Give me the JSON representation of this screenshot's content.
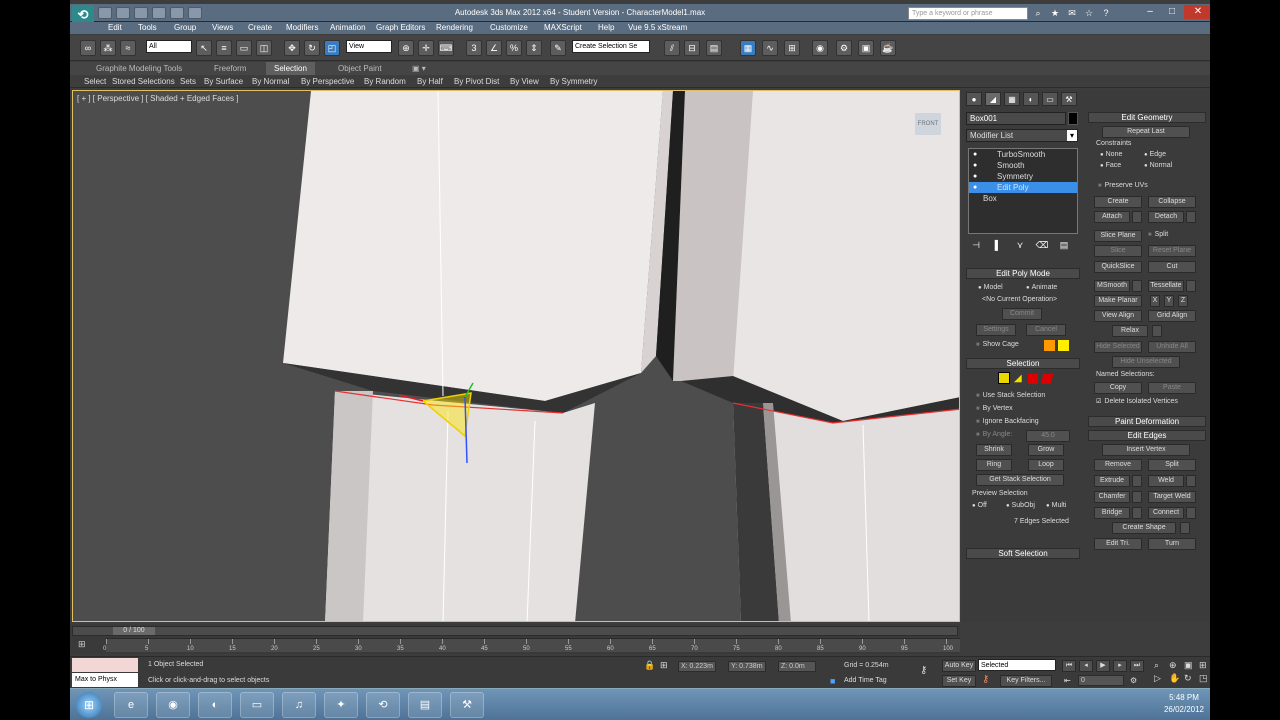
{
  "window": {
    "title": "Autodesk 3ds Max 2012 x64 - Student Version - CharacterModel1.max",
    "search_placeholder": "Type a keyword or phrase"
  },
  "menu": [
    "Edit",
    "Tools",
    "Group",
    "Views",
    "Create",
    "Modifiers",
    "Animation",
    "Graph Editors",
    "Rendering",
    "Customize",
    "MAXScript",
    "Help",
    "Vue 9.5 xStream"
  ],
  "toolbar": {
    "selection_filter": "All",
    "ref_coord": "View",
    "named_selection": "Create Selection Se"
  },
  "ribbon": {
    "tabs": [
      "Graphite Modeling Tools",
      "Freeform",
      "Selection",
      "Object Paint"
    ],
    "active_tab": "Selection",
    "sub_items": [
      "Select",
      "Stored Selections",
      "Sets",
      "By Surface",
      "By Normal",
      "By Perspective",
      "By Random",
      "By Half",
      "By Pivot Dist",
      "By View",
      "By Symmetry"
    ]
  },
  "viewport": {
    "label": "[ + ] [ Perspective ] [ Shaded + Edged Faces ]",
    "viewcube": "FRONT"
  },
  "command_panel": {
    "object_name": "Box001",
    "object_color": "#000000",
    "modifier_list": "Modifier List",
    "stack": [
      "TurboSmooth",
      "Smooth",
      "Symmetry",
      "Edit Poly",
      "Box"
    ],
    "selected_stack_item": "Edit Poly",
    "edit_poly_mode": {
      "title": "Edit Poly Mode",
      "model": "Model",
      "animate": "Animate",
      "operation": "<No Current Operation>",
      "commit": "Commit",
      "settings": "Settings",
      "cancel": "Cancel",
      "show_cage": "Show Cage",
      "cage_colors": [
        "#ff9900",
        "#ffee00"
      ]
    },
    "selection": {
      "title": "Selection",
      "use_stack": "Use Stack Selection",
      "by_vertex": "By Vertex",
      "ignore_backfacing": "Ignore Backfacing",
      "by_angle": "By Angle:",
      "angle_value": "45.0",
      "shrink": "Shrink",
      "grow": "Grow",
      "ring": "Ring",
      "loop": "Loop",
      "get_stack": "Get Stack Selection",
      "preview": "Preview Selection",
      "off": "Off",
      "subobj": "SubObj",
      "multi": "Multi",
      "count": "7 Edges Selected"
    },
    "soft_selection": "Soft Selection",
    "edit_geometry": {
      "title": "Edit Geometry",
      "repeat_last": "Repeat Last",
      "constraints": "Constraints",
      "none": "None",
      "edge": "Edge",
      "face": "Face",
      "normal": "Normal",
      "preserve_uvs": "Preserve UVs",
      "create": "Create",
      "collapse": "Collapse",
      "attach": "Attach",
      "detach": "Detach",
      "slice_plane": "Slice Plane",
      "split": "Split",
      "slice": "Slice",
      "reset_plane": "Reset Plane",
      "quickslice": "QuickSlice",
      "cut": "Cut",
      "msmooth": "MSmooth",
      "tessellate": "Tessellate",
      "make_planar": "Make Planar",
      "x": "X",
      "y": "Y",
      "z": "Z",
      "view_align": "View Align",
      "grid_align": "Grid Align",
      "relax": "Relax",
      "hide_selected": "Hide Selected",
      "unhide_all": "Unhide All",
      "hide_unselected": "Hide Unselected",
      "named_selections": "Named Selections:",
      "copy": "Copy",
      "paste": "Paste",
      "delete_isolated": "Delete Isolated Vertices"
    },
    "paint_deformation": "Paint Deformation",
    "edit_edges": {
      "title": "Edit Edges",
      "insert_vertex": "Insert Vertex",
      "remove": "Remove",
      "split": "Split",
      "extrude": "Extrude",
      "weld": "Weld",
      "chamfer": "Chamfer",
      "target_weld": "Target Weld",
      "bridge": "Bridge",
      "connect": "Connect",
      "create_shape": "Create Shape",
      "edit_tri": "Edit Tri.",
      "turn": "Turn"
    }
  },
  "timeline": {
    "frame": "0 / 100",
    "ticks": [
      "0",
      "5",
      "10",
      "15",
      "20",
      "25",
      "30",
      "35",
      "40",
      "45",
      "50",
      "55",
      "60",
      "65",
      "70",
      "75",
      "80",
      "85",
      "90",
      "95",
      "100"
    ]
  },
  "status": {
    "maxscript_listener": "Max to Physx",
    "selected": "1 Object Selected",
    "prompt": "Click or click-and-drag to select objects",
    "x": "X: 0.223m",
    "y": "Y: 0.738m",
    "z": "Z: 0.0m",
    "grid": "Grid = 0.254m",
    "add_time_tag": "Add Time Tag",
    "auto_key": "Auto Key",
    "set_key": "Set Key",
    "key_mode": "Selected",
    "key_filters": "Key Filters...",
    "frame_value": "0"
  },
  "taskbar": {
    "time": "5:48 PM",
    "date": "26/02/2012"
  }
}
